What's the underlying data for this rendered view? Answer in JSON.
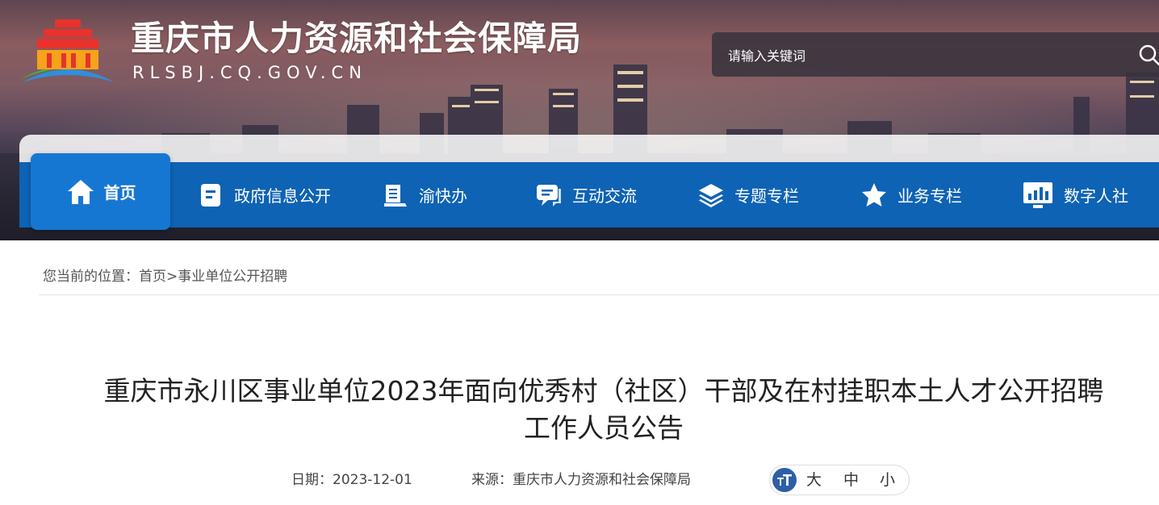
{
  "header": {
    "site_name": "重庆市人力资源和社会保障局",
    "site_domain": "RLSBJ.CQ.GOV.CN",
    "search": {
      "placeholder": "请输入关键词"
    }
  },
  "nav": {
    "items": [
      {
        "label": "首页",
        "icon": "home-icon",
        "active": true
      },
      {
        "label": "政府信息公开",
        "icon": "document-icon"
      },
      {
        "label": "渝快办",
        "icon": "book-icon"
      },
      {
        "label": "互动交流",
        "icon": "chat-icon"
      },
      {
        "label": "专题专栏",
        "icon": "layers-icon"
      },
      {
        "label": "业务专栏",
        "icon": "star-icon"
      },
      {
        "label": "数字人社",
        "icon": "chart-monitor-icon"
      }
    ]
  },
  "breadcrumb": {
    "prefix": "您当前的位置：",
    "home": "首页",
    "separator": ">",
    "current": "事业单位公开招聘"
  },
  "article": {
    "title_line1": "重庆市永川区事业单位2023年面向优秀村（社区）干部及在村挂职本土人才公开招聘",
    "title_line2": "工作人员公告",
    "date_label": "日期：",
    "date": "2023-12-01",
    "source_label": "来源：",
    "source": "重庆市人力资源和社会保障局",
    "font_sizes": [
      "大",
      "中",
      "小"
    ]
  },
  "colors": {
    "nav_bg": "#0e63b4",
    "nav_active": "#1677d2",
    "font_icon_bg": "#2d5fa8"
  }
}
